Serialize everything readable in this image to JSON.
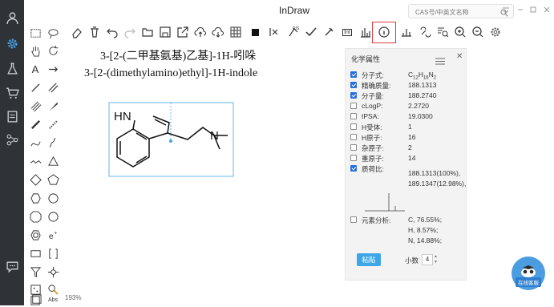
{
  "window": {
    "title": "InDraw"
  },
  "search": {
    "placeholder": "CAS号/中英文名称"
  },
  "document": {
    "name_cn": "3-[2-(二甲基氨基)乙基]-1H-吲哚",
    "name_en": "3-[2-(dimethylamino)ethyl]-1H-indole",
    "atom_label_nh": "HN",
    "atom_label_n": "N",
    "zoom": "193%"
  },
  "palette": {
    "text_tool_label": "A",
    "abs_label": "Abs"
  },
  "toolbar": {
    "int_label": "Int"
  },
  "properties": {
    "title": "化学属性",
    "rows": [
      {
        "label": "分子式:",
        "value": "C12H16N2",
        "checked": true
      },
      {
        "label": "精确质量:",
        "value": "188.1313",
        "checked": true
      },
      {
        "label": "分子量:",
        "value": "188.2740",
        "checked": true
      },
      {
        "label": "cLogP:",
        "value": "2.2720",
        "checked": false
      },
      {
        "label": "tPSA:",
        "value": "19.0300",
        "checked": false
      },
      {
        "label": "H受体:",
        "value": "1",
        "checked": false
      },
      {
        "label": "H原子:",
        "value": "16",
        "checked": false
      },
      {
        "label": "杂原子:",
        "value": "2",
        "checked": false
      },
      {
        "label": "重原子:",
        "value": "14",
        "checked": false
      },
      {
        "label": "质荷比:",
        "value": "",
        "checked": true
      }
    ],
    "formula": {
      "c": "C",
      "c_n": "12",
      "h": "H",
      "h_n": "16",
      "n": "N",
      "n_n": "2"
    },
    "mass_spec": [
      "188.1313(100%),",
      "189.1347(12.98%),"
    ],
    "elemental": {
      "label": "元素分析:",
      "checked": false,
      "values": [
        "C, 76.55%;",
        "H, 8.57%;",
        "N, 14.88%;"
      ]
    },
    "paste_label": "粘贴",
    "decimals_label": "小数",
    "decimals_value": "4"
  },
  "support": {
    "label": "在线客服"
  },
  "colors": {
    "accent": "#2a6fdb",
    "highlight": "#e03b3b",
    "rail": "#2f3237",
    "selection": "#3ea6e6"
  }
}
